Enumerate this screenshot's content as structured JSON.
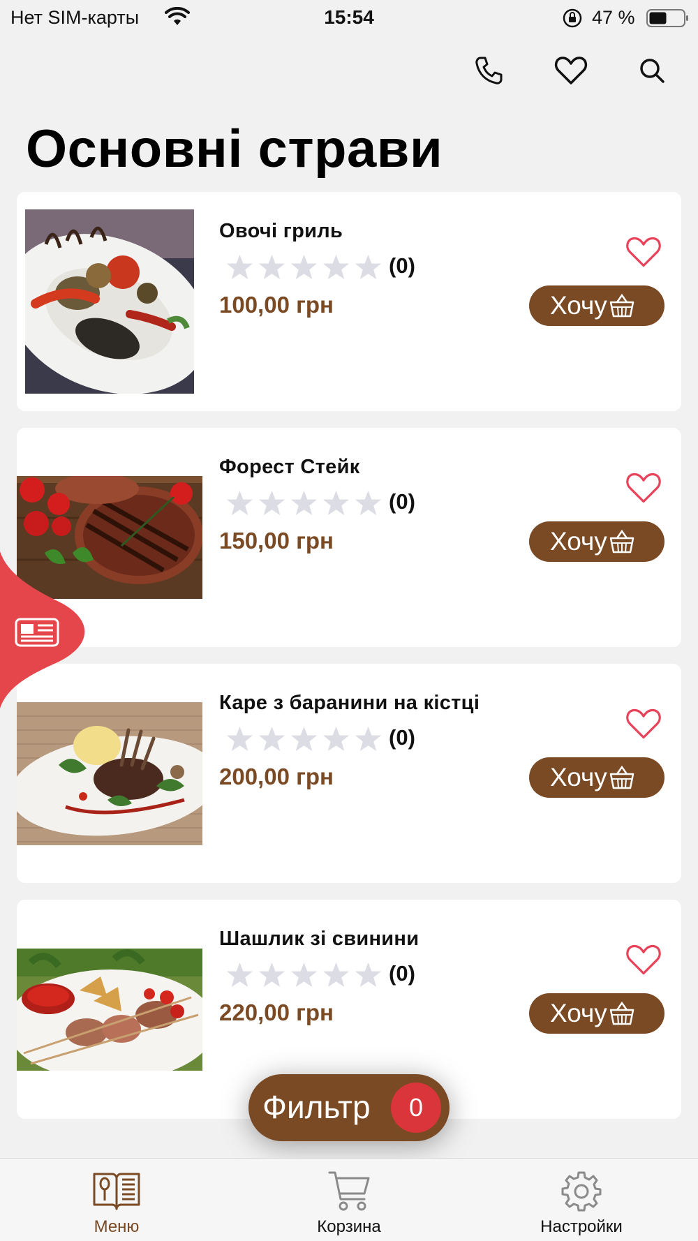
{
  "status_bar": {
    "carrier": "Нет SIM-карты",
    "time": "15:54",
    "battery_percent": "47 %"
  },
  "header": {
    "icons": [
      "phone-icon",
      "heart-icon",
      "search-icon"
    ],
    "title": "Основні страви"
  },
  "products": [
    {
      "name": "Овочі гриль",
      "rating_count": "(0)",
      "stars": 0,
      "price": "100,00 грн",
      "button": "Хочу"
    },
    {
      "name": "Форест Стейк",
      "rating_count": "(0)",
      "stars": 0,
      "price": "150,00 грн",
      "button": "Хочу"
    },
    {
      "name": "Каре з баранини на кістці",
      "rating_count": "(0)",
      "stars": 0,
      "price": "200,00 грн",
      "button": "Хочу"
    },
    {
      "name": "Шашлик зі свинини",
      "rating_count": "(0)",
      "stars": 0,
      "price": "220,00 грн",
      "button": "Хочу"
    }
  ],
  "filter": {
    "label": "Фильтр",
    "count": "0"
  },
  "bottom_nav": [
    {
      "label": "Меню",
      "icon": "menu-book-icon",
      "active": true
    },
    {
      "label": "Корзина",
      "icon": "cart-icon",
      "active": false
    },
    {
      "label": "Настройки",
      "icon": "gear-icon",
      "active": false
    }
  ],
  "colors": {
    "accent": "#7a4a24",
    "heart": "#e8435a",
    "badge": "#d9353a",
    "side_tab": "#e5464b",
    "star_empty": "#dcdce4",
    "background": "#f1f1f1"
  }
}
